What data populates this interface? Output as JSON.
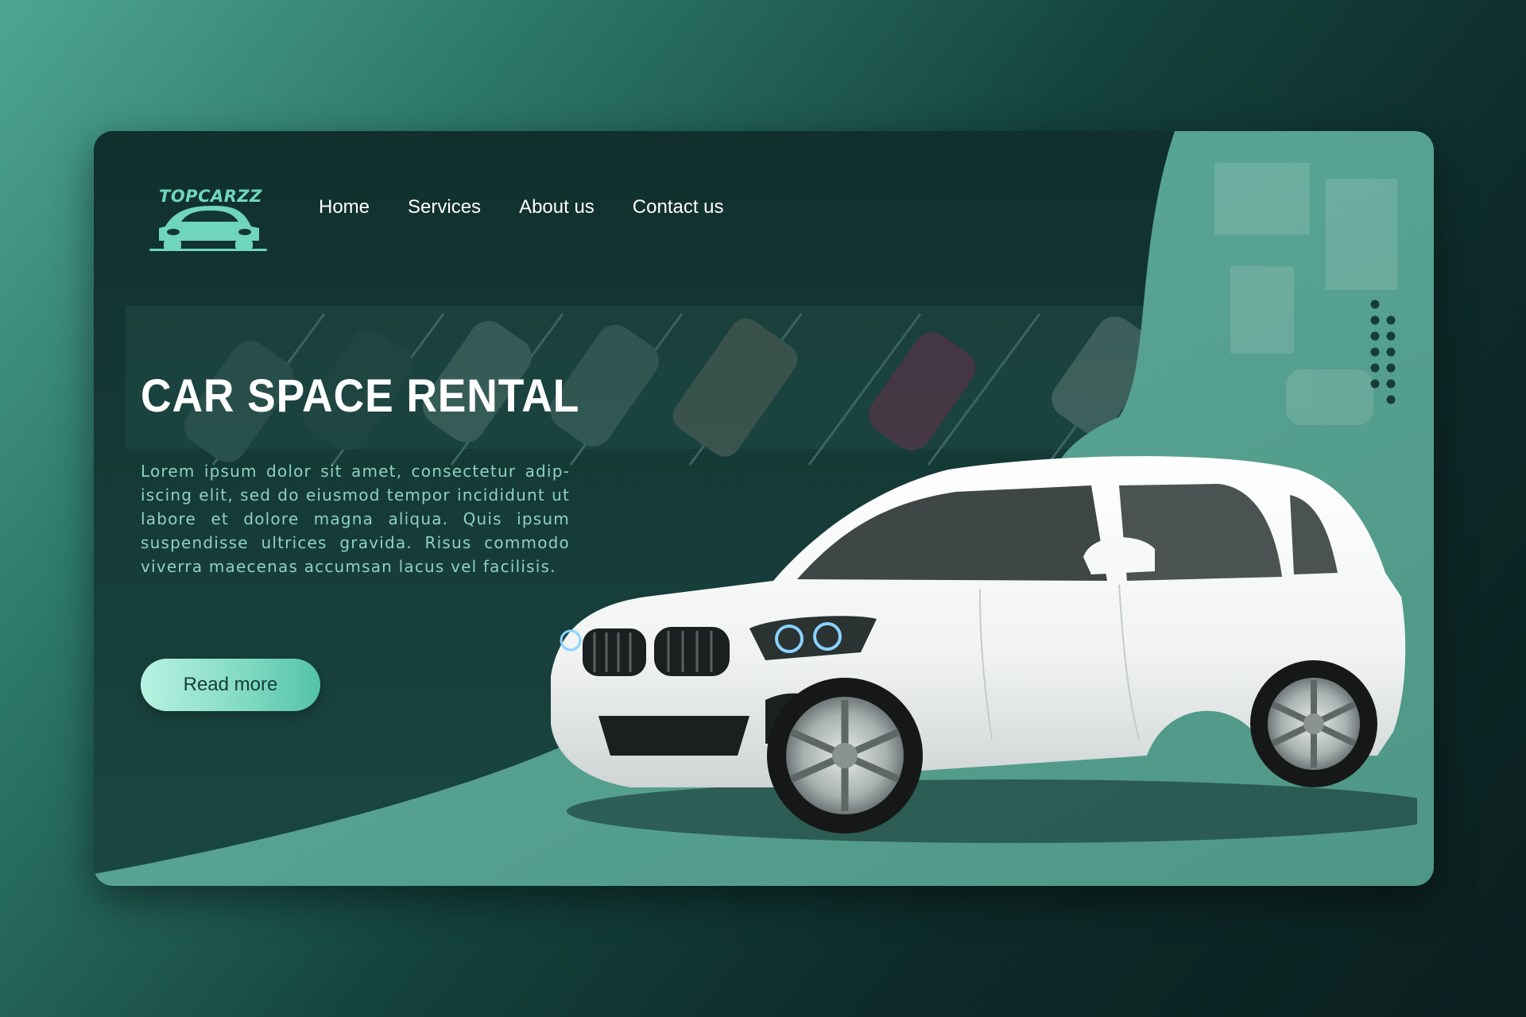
{
  "brand": {
    "logo_text": "TOPCARZZ",
    "accent_color": "#6fd6bd"
  },
  "nav": {
    "items": [
      {
        "label": "Home"
      },
      {
        "label": "Services"
      },
      {
        "label": "About us"
      },
      {
        "label": "Contact us"
      }
    ]
  },
  "hero": {
    "title": "CAR SPACE RENTAL",
    "body": "Lorem ipsum dolor sit amet, consectetur adip-iscing elit, sed do eiusmod tempor incididunt ut labore et dolore magna aliqua. Quis ipsum suspendisse ultrices gravida. Risus commodo viverra maecenas accumsan lacus vel facilisis.",
    "cta_label": "Read more"
  },
  "colors": {
    "background_dark": "#0d2a28",
    "panel_teal": "#5aa594",
    "button_gradient_start": "#b8f3e2",
    "button_gradient_end": "#53c3a8"
  },
  "icons": {
    "logo": "car-front-icon",
    "decoration": "dot-grid-icon",
    "hero_image": "white-hatchback-car"
  }
}
